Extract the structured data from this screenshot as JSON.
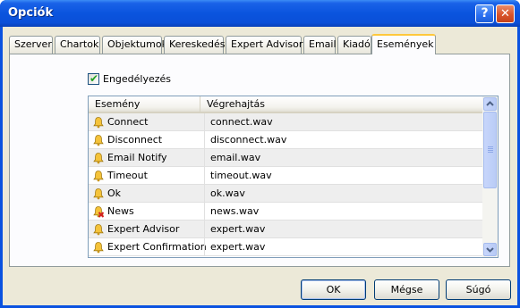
{
  "window": {
    "title": "Opciók",
    "help_glyph": "?",
    "close_glyph": "✕"
  },
  "tabs": [
    {
      "label": "Szerver"
    },
    {
      "label": "Chartok"
    },
    {
      "label": "Objektumok"
    },
    {
      "label": "Kereskedés"
    },
    {
      "label": "Expert Advisors"
    },
    {
      "label": "Email"
    },
    {
      "label": "Kiadó"
    },
    {
      "label": "Események",
      "active": true
    }
  ],
  "enable": {
    "label": "Engedélyezés",
    "checked": true
  },
  "events_list": {
    "columns": [
      "Esemény",
      "Végrehajtás"
    ],
    "rows": [
      {
        "event": "Connect",
        "action": "connect.wav",
        "icon": "bell-icon"
      },
      {
        "event": "Disconnect",
        "action": "disconnect.wav",
        "icon": "bell-icon"
      },
      {
        "event": "Email Notify",
        "action": "email.wav",
        "icon": "bell-icon"
      },
      {
        "event": "Timeout",
        "action": "timeout.wav",
        "icon": "bell-icon"
      },
      {
        "event": "Ok",
        "action": "ok.wav",
        "icon": "bell-icon"
      },
      {
        "event": "News",
        "action": "news.wav",
        "icon": "bell-disabled-icon"
      },
      {
        "event": "Expert Advisor",
        "action": "expert.wav",
        "icon": "bell-icon"
      },
      {
        "event": "Expert Confirmation",
        "action": "expert.wav",
        "icon": "bell-icon"
      }
    ]
  },
  "buttons": {
    "ok": "OK",
    "cancel": "Mégse",
    "help": "Súgó"
  },
  "colors": {
    "titlebar": "#0a54de",
    "tab_highlight": "#ffc83c",
    "dialog_bg": "#ece9d8"
  }
}
